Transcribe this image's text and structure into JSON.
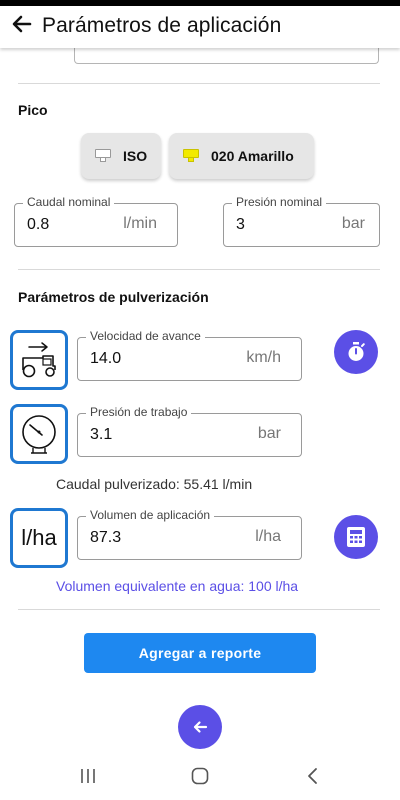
{
  "appbar": {
    "title": "Parámetros de aplicación"
  },
  "nozzle": {
    "section_title": "Pico",
    "chips": [
      {
        "label": "ISO",
        "color": "#ffffff"
      },
      {
        "label": "020 Amarillo",
        "color": "#f2ea00"
      }
    ],
    "flow_field": {
      "label": "Caudal nominal",
      "value": "0.8",
      "unit": "l/min"
    },
    "pressure_field": {
      "label": "Presión nominal",
      "value": "3",
      "unit": "bar"
    }
  },
  "spray": {
    "section_title": "Parámetros de pulverización",
    "speed_field": {
      "label": "Velocidad de avance",
      "value": "14.0",
      "unit": "km/h"
    },
    "work_pressure_field": {
      "label": "Presión de trabajo",
      "value": "3.1",
      "unit": "bar"
    },
    "sprayed_flow_text": "Caudal pulverizado: 55.41 l/min",
    "volume_icon_text": "l/ha",
    "volume_field": {
      "label": "Volumen de aplicación",
      "value": "87.3",
      "unit": "l/ha"
    },
    "water_equivalent_text": "Volumen equivalente en agua: 100 l/ha"
  },
  "actions": {
    "add_report_label": "Agregar a reporte"
  },
  "colors": {
    "accent": "#1e88f0",
    "fab": "#5b4fe6",
    "icon_border": "#1f78d1",
    "info_purple": "#5b4fe6"
  }
}
